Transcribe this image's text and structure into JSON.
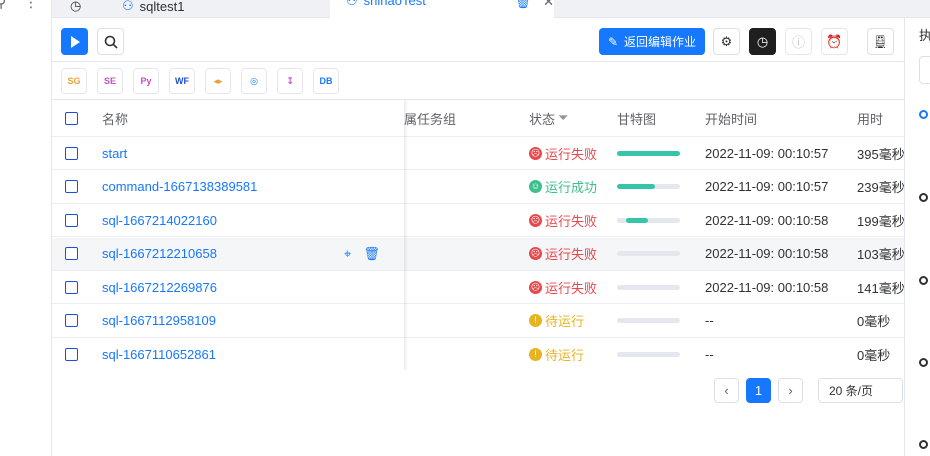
{
  "tabs": [
    {
      "label": "sqltest1"
    },
    {
      "label": "shihaoTest"
    }
  ],
  "toolbar": {
    "return_label": "返回编辑作业"
  },
  "node_types": [
    {
      "abbr": "SG",
      "color": "#e6a23c"
    },
    {
      "abbr": "SE",
      "color": "#c050c8"
    },
    {
      "abbr": "Py",
      "color": "#c050c8"
    },
    {
      "abbr": "WF",
      "color": "#1d4ed8"
    },
    {
      "abbr": "◂▸",
      "color": "#e6a23c"
    },
    {
      "abbr": "◎",
      "color": "#1677ff"
    },
    {
      "abbr": "↧",
      "color": "#c050c8"
    },
    {
      "abbr": "DB",
      "color": "#1677ff"
    }
  ],
  "table": {
    "columns": {
      "name": "名称",
      "group": "属任务组",
      "status": "状态",
      "gantt": "甘特图",
      "start_time": "开始时间",
      "duration": "用时"
    },
    "rows": [
      {
        "name": "start",
        "status": "运行失败",
        "status_type": "fail",
        "gantt_start": 0,
        "gantt_width": 1.0,
        "start_time": "2022-11-09: 00:10:57",
        "duration": "395毫秒"
      },
      {
        "name": "command-1667138389581",
        "status": "运行成功",
        "status_type": "success",
        "gantt_start": 0,
        "gantt_width": 0.6,
        "start_time": "2022-11-09: 00:10:57",
        "duration": "239毫秒"
      },
      {
        "name": "sql-1667214022160",
        "status": "运行失败",
        "status_type": "fail",
        "gantt_start": 0.15,
        "gantt_width": 0.35,
        "start_time": "2022-11-09: 00:10:58",
        "duration": "199毫秒"
      },
      {
        "name": "sql-1667212210658",
        "status": "运行失败",
        "status_type": "fail",
        "gantt_start": 0,
        "gantt_width": 0,
        "start_time": "2022-11-09: 00:10:58",
        "duration": "103毫秒"
      },
      {
        "name": "sql-1667212269876",
        "status": "运行失败",
        "status_type": "fail",
        "gantt_start": 0,
        "gantt_width": 0,
        "start_time": "2022-11-09: 00:10:58",
        "duration": "141毫秒"
      },
      {
        "name": "sql-1667112958109",
        "status": "待运行",
        "status_type": "pending",
        "gantt_start": 0,
        "gantt_width": 0,
        "start_time": "--",
        "duration": "0毫秒"
      },
      {
        "name": "sql-1667110652861",
        "status": "待运行",
        "status_type": "pending",
        "gantt_start": 0,
        "gantt_width": 0,
        "start_time": "--",
        "duration": "0毫秒"
      }
    ]
  },
  "pagination": {
    "current_page": "1",
    "page_size": "20 条/页"
  },
  "right_panel": {
    "title": "执"
  },
  "colors": {
    "primary": "#1677ff",
    "fail": "#e5484d",
    "success": "#3ec08a",
    "pending": "#e6b422",
    "gantt": "#36c5a8"
  }
}
